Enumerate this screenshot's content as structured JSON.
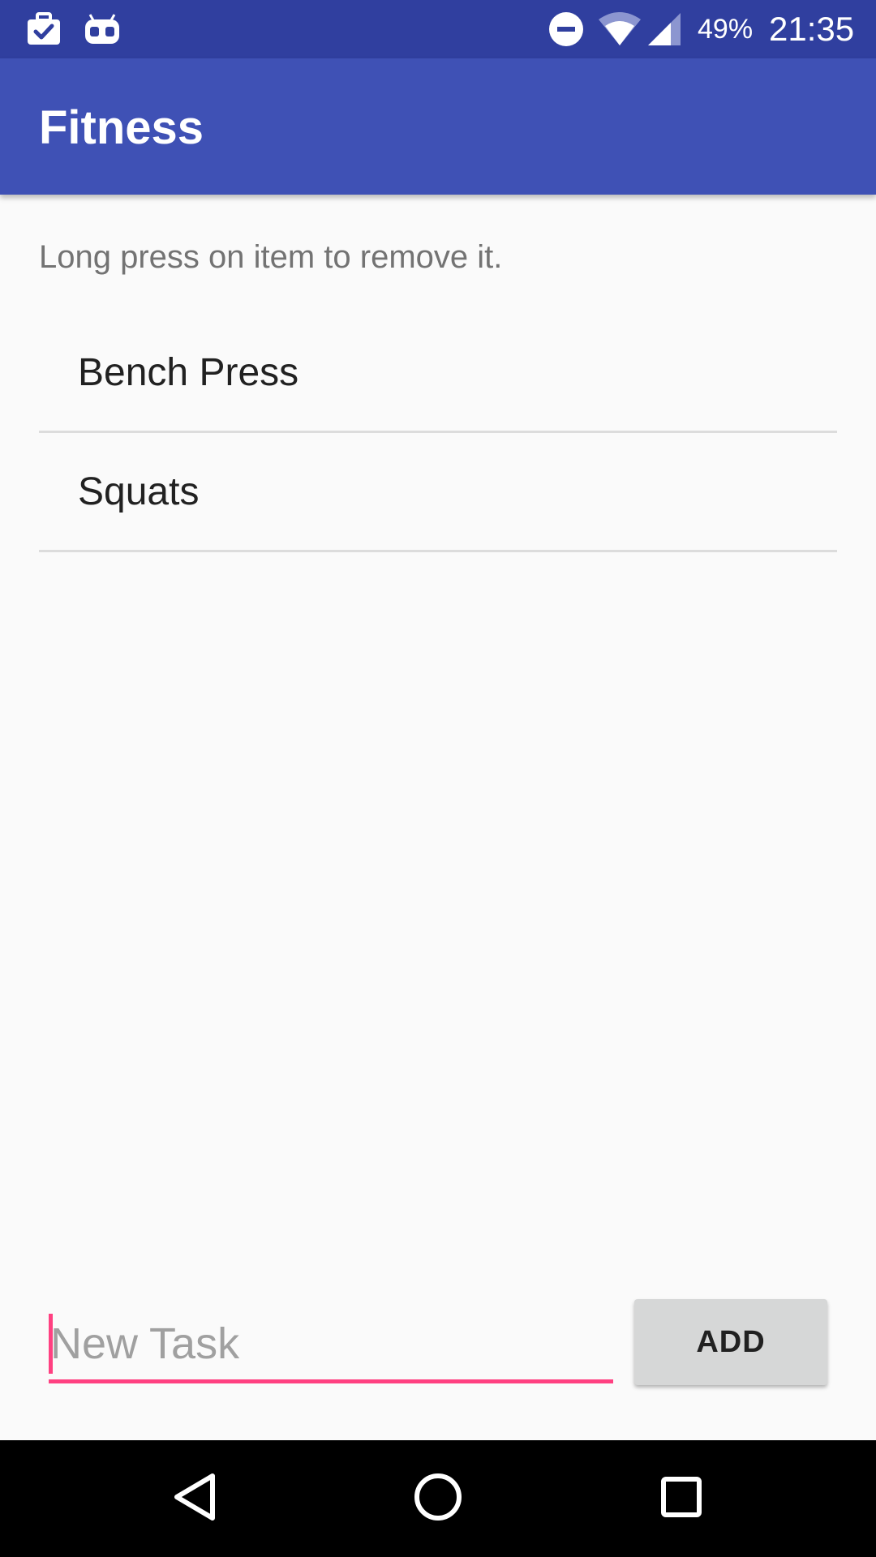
{
  "status_bar": {
    "battery": "49%",
    "time": "21:35",
    "icons": [
      "briefcase-check-icon",
      "android-robot-icon",
      "do-not-disturb-icon",
      "wifi-icon",
      "cell-signal-icon"
    ]
  },
  "app_bar": {
    "title": "Fitness"
  },
  "main": {
    "hint": "Long press on item to remove it.",
    "tasks": [
      "Bench Press",
      "Squats"
    ]
  },
  "input": {
    "placeholder": "New Task",
    "value": ""
  },
  "add_button": {
    "label": "ADD"
  },
  "nav_bar": {
    "icons": [
      "back-icon",
      "home-icon",
      "recents-icon"
    ]
  },
  "colors": {
    "status_bar": "#303f9f",
    "app_bar": "#3f51b5",
    "accent": "#ff4081",
    "background": "#fafafa"
  }
}
